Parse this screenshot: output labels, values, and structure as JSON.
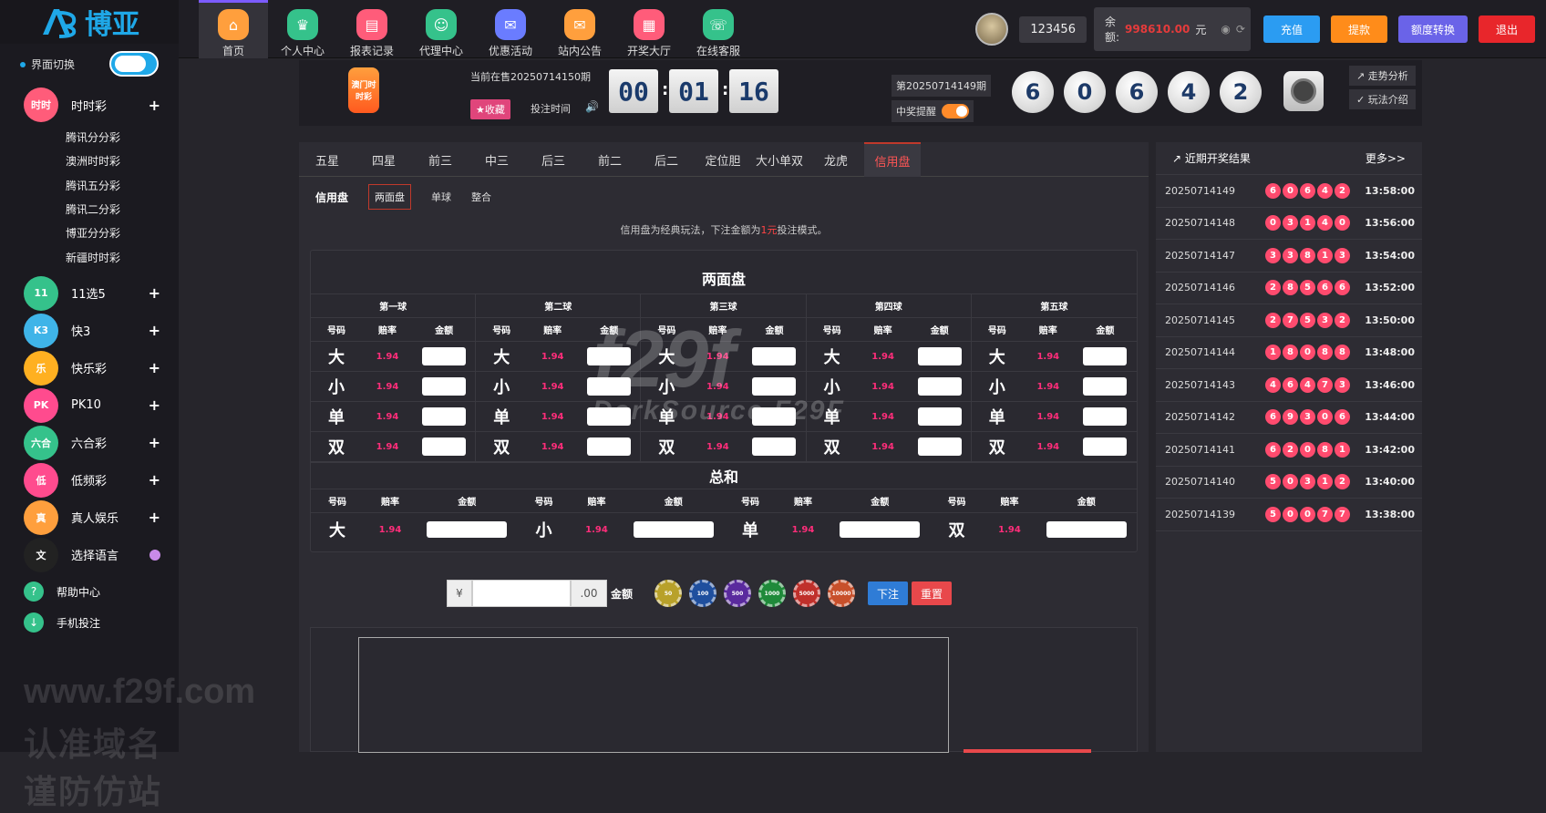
{
  "brand": {
    "name": "博亚",
    "color": "#1fa8e8"
  },
  "top_nav": [
    {
      "label": "首页",
      "icon": "home-icon",
      "color": "#ff9f3d",
      "active": true
    },
    {
      "label": "个人中心",
      "icon": "crown-icon",
      "color": "#35c28b",
      "active": false
    },
    {
      "label": "报表记录",
      "icon": "report-icon",
      "color": "#ff5c7a",
      "active": false
    },
    {
      "label": "代理中心",
      "icon": "agent-icon",
      "color": "#35c28b",
      "active": false
    },
    {
      "label": "优惠活动",
      "icon": "gift-icon",
      "color": "#6a7cff",
      "active": false
    },
    {
      "label": "站内公告",
      "icon": "mail-icon",
      "color": "#ff9f3d",
      "active": false
    },
    {
      "label": "开奖大厅",
      "icon": "grid-icon",
      "color": "#ff5c7a",
      "active": false
    },
    {
      "label": "在线客服",
      "icon": "support-icon",
      "color": "#35c28b",
      "active": false
    }
  ],
  "user": {
    "username": "123456",
    "balance_label": "余额:",
    "balance_value": "998610.00",
    "balance_unit": "元",
    "buttons": [
      {
        "label": "充值",
        "color": "#2b9cf2"
      },
      {
        "label": "提款",
        "color": "#ff8c1a"
      },
      {
        "label": "额度转换",
        "color": "#6a63e8"
      },
      {
        "label": "退出",
        "color": "#e8262b"
      }
    ]
  },
  "sidebar": {
    "switch_label": "界面切换",
    "categories": [
      {
        "label": "时时彩",
        "icon": "ssc-icon",
        "color": "#ff5c7a",
        "short": "时时",
        "expanded": true,
        "subitems": [
          "腾讯分分彩",
          "澳洲时时彩",
          "腾讯五分彩",
          "腾讯二分彩",
          "博亚分分彩",
          "新疆时时彩"
        ]
      },
      {
        "label": "11选5",
        "icon": "11x5-icon",
        "color": "#35c28b",
        "short": "11"
      },
      {
        "label": "快3",
        "icon": "k3-icon",
        "color": "#3fb4e8",
        "short": "K3"
      },
      {
        "label": "快乐彩",
        "icon": "happy-icon",
        "color": "#ffb021",
        "short": "乐"
      },
      {
        "label": "PK10",
        "icon": "pk10-icon",
        "color": "#ff4b8e",
        "short": "PK"
      },
      {
        "label": "六合彩",
        "icon": "lhc-icon",
        "color": "#35c28b",
        "short": "六合"
      },
      {
        "label": "低频彩",
        "icon": "lowfreq-icon",
        "color": "#ff4b8e",
        "short": "低"
      },
      {
        "label": "真人娱乐",
        "icon": "live-icon",
        "color": "#ff9f3d",
        "short": "真"
      },
      {
        "label": "选择语言",
        "icon": "language-icon",
        "color": "#222",
        "short": "文"
      }
    ],
    "help": [
      {
        "label": "帮助中心",
        "icon": "help-icon",
        "color": "#35c28b"
      },
      {
        "label": "手机投注",
        "icon": "download-icon",
        "color": "#35c28b"
      }
    ],
    "watermark_site": "www.f29f.com",
    "watermark_cn": "认准域名谨防仿站"
  },
  "game_header": {
    "lottery_logo_text": "澳门时时彩",
    "current_issue": "当前在售20250714150期",
    "fav_label": "★收藏",
    "bet_time_label": "投注时间",
    "countdown": [
      "00",
      "01",
      "16"
    ],
    "last_issue": "第20250714149期",
    "remind_label": "中奖提醒",
    "result_balls": [
      "6",
      "0",
      "6",
      "4",
      "2"
    ],
    "trend_label": "走势分析",
    "rules_label": "玩法介绍"
  },
  "play_tabs": [
    "五星",
    "四星",
    "前三",
    "中三",
    "后三",
    "前二",
    "后二",
    "定位胆",
    "大小单双",
    "龙虎",
    "信用盘"
  ],
  "active_tab": "信用盘",
  "subtabs": {
    "title": "信用盘",
    "items": [
      "两面盘",
      "单球",
      "整合"
    ]
  },
  "note": {
    "prefix": "信用盘为经典玩法，下注金额为",
    "highlight": "1元",
    "suffix": "投注模式。"
  },
  "board": {
    "title": "两面盘",
    "col_headers": {
      "num": "号码",
      "odds": "赔率",
      "amount": "金额"
    },
    "balls": [
      {
        "name": "第一球",
        "rows": [
          {
            "num": "大",
            "odds": "1.94"
          },
          {
            "num": "小",
            "odds": "1.94"
          },
          {
            "num": "单",
            "odds": "1.94"
          },
          {
            "num": "双",
            "odds": "1.94"
          }
        ]
      },
      {
        "name": "第二球",
        "rows": [
          {
            "num": "大",
            "odds": "1.94"
          },
          {
            "num": "小",
            "odds": "1.94"
          },
          {
            "num": "单",
            "odds": "1.94"
          },
          {
            "num": "双",
            "odds": "1.94"
          }
        ]
      },
      {
        "name": "第三球",
        "rows": [
          {
            "num": "大",
            "odds": "1.94"
          },
          {
            "num": "小",
            "odds": "1.94"
          },
          {
            "num": "单",
            "odds": "1.94"
          },
          {
            "num": "双",
            "odds": "1.94"
          }
        ]
      },
      {
        "name": "第四球",
        "rows": [
          {
            "num": "大",
            "odds": "1.94"
          },
          {
            "num": "小",
            "odds": "1.94"
          },
          {
            "num": "单",
            "odds": "1.94"
          },
          {
            "num": "双",
            "odds": "1.94"
          }
        ]
      },
      {
        "name": "第五球",
        "rows": [
          {
            "num": "大",
            "odds": "1.94"
          },
          {
            "num": "小",
            "odds": "1.94"
          },
          {
            "num": "单",
            "odds": "1.94"
          },
          {
            "num": "双",
            "odds": "1.94"
          }
        ]
      }
    ],
    "sum_title": "总和",
    "sum_items": [
      {
        "num": "大",
        "odds": "1.94"
      },
      {
        "num": "小",
        "odds": "1.94"
      },
      {
        "num": "单",
        "odds": "1.94"
      },
      {
        "num": "双",
        "odds": "1.94"
      }
    ]
  },
  "bet_bar": {
    "currency": "¥",
    "decimals": ".00",
    "amount_label": "金额",
    "chips": [
      {
        "value": "50",
        "color": "#b8a12a"
      },
      {
        "value": "100",
        "color": "#1f4f9e"
      },
      {
        "value": "500",
        "color": "#5a2a9e"
      },
      {
        "value": "1000",
        "color": "#1f8a3a"
      },
      {
        "value": "5000",
        "color": "#c0302b"
      },
      {
        "value": "10000",
        "color": "#c8502b"
      }
    ],
    "submit_label": "下注",
    "reset_label": "重置"
  },
  "watermark": {
    "big": "f29f",
    "small": "DarkSource F29F"
  },
  "recent": {
    "title": "近期开奖结果",
    "more_label": "更多>>",
    "rows": [
      {
        "issue": "20250714149",
        "balls": [
          "6",
          "0",
          "6",
          "4",
          "2"
        ],
        "time": "13:58:00"
      },
      {
        "issue": "20250714148",
        "balls": [
          "0",
          "3",
          "1",
          "4",
          "0"
        ],
        "time": "13:56:00"
      },
      {
        "issue": "20250714147",
        "balls": [
          "3",
          "3",
          "8",
          "1",
          "3"
        ],
        "time": "13:54:00"
      },
      {
        "issue": "20250714146",
        "balls": [
          "2",
          "8",
          "5",
          "6",
          "6"
        ],
        "time": "13:52:00"
      },
      {
        "issue": "20250714145",
        "balls": [
          "2",
          "7",
          "5",
          "3",
          "2"
        ],
        "time": "13:50:00"
      },
      {
        "issue": "20250714144",
        "balls": [
          "1",
          "8",
          "0",
          "8",
          "8"
        ],
        "time": "13:48:00"
      },
      {
        "issue": "20250714143",
        "balls": [
          "4",
          "6",
          "4",
          "7",
          "3"
        ],
        "time": "13:46:00"
      },
      {
        "issue": "20250714142",
        "balls": [
          "6",
          "9",
          "3",
          "0",
          "6"
        ],
        "time": "13:44:00"
      },
      {
        "issue": "20250714141",
        "balls": [
          "6",
          "2",
          "0",
          "8",
          "1"
        ],
        "time": "13:42:00"
      },
      {
        "issue": "20250714140",
        "balls": [
          "5",
          "0",
          "3",
          "1",
          "2"
        ],
        "time": "13:40:00"
      },
      {
        "issue": "20250714139",
        "balls": [
          "5",
          "0",
          "0",
          "7",
          "7"
        ],
        "time": "13:38:00"
      }
    ]
  }
}
